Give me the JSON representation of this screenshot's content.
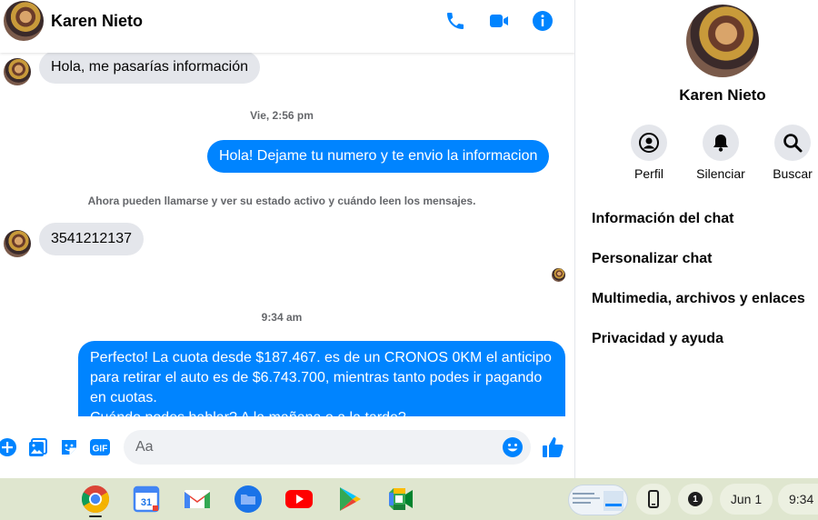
{
  "contact": {
    "name": "Karen Nieto"
  },
  "messages": {
    "m1": "Hola, me pasarías información",
    "t1": "Vie, 2:56 pm",
    "m2": "Hola! Dejame tu numero y te envio la informacion",
    "sys1": "Ahora pueden llamarse y ver su estado activo y cuándo leen los mensajes.",
    "m3": "3541212137",
    "t2": "9:34 am",
    "m4": "Perfecto! La cuota desde $187.467. es de un CRONOS 0KM el anticipo para retirar el auto es de $6.743.700, mientras tanto podes ir pagando en cuotas.",
    "m4_cont": "Cuándo podes hablar? A la mañana o a la tarde?"
  },
  "composer": {
    "placeholder": "Aa"
  },
  "side": {
    "name": "Karen Nieto",
    "actions": [
      {
        "label": "Perfil",
        "icon": "person-icon"
      },
      {
        "label": "Silenciar",
        "icon": "bell-icon"
      },
      {
        "label": "Buscar",
        "icon": "search-icon"
      }
    ],
    "menu": [
      "Información del chat",
      "Personalizar chat",
      "Multimedia, archivos y enlaces",
      "Privacidad y ayuda"
    ]
  },
  "shelf": {
    "apps": [
      "chrome-icon",
      "calendar-icon",
      "gmail-icon",
      "files-icon",
      "youtube-icon",
      "play-store-icon",
      "meet-icon"
    ],
    "calendar_day": "31",
    "notification_count": "1",
    "date": "Jun 1",
    "time": "9:34"
  },
  "colors": {
    "accent": "#0084ff",
    "bubble_in": "#e4e6eb",
    "shelf": "#dfe6cf"
  }
}
